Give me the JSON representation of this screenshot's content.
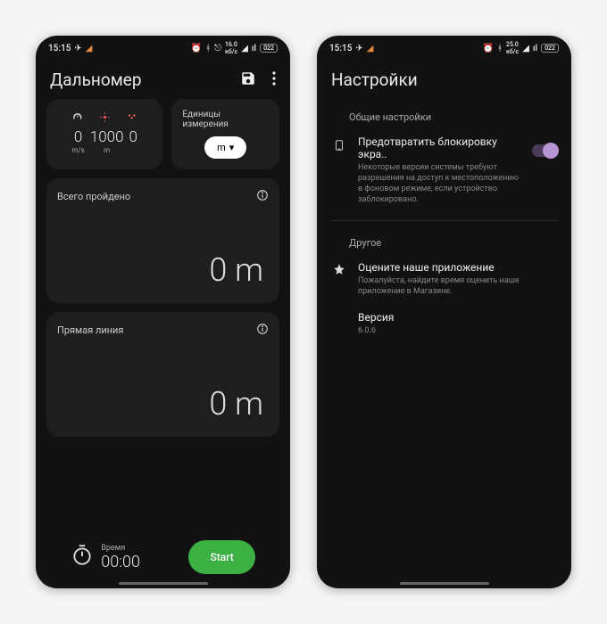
{
  "screen1": {
    "status": {
      "time": "15:15",
      "battery": "022"
    },
    "header": {
      "title": "Дальномер"
    },
    "stats": {
      "speed": {
        "value": "0",
        "unit": "m/s"
      },
      "accuracy": {
        "value": "1000",
        "unit": "m"
      },
      "sats": {
        "value": "0",
        "unit": ""
      }
    },
    "units": {
      "title": "Единицы измерения",
      "selected": "m"
    },
    "card1": {
      "title": "Всего пройдено",
      "value": "0 m"
    },
    "card2": {
      "title": "Прямая линия",
      "value": "0 m"
    },
    "time": {
      "label": "Время",
      "value": "00:00"
    },
    "start": "Start"
  },
  "screen2": {
    "status": {
      "time": "15:15",
      "battery": "022"
    },
    "header": {
      "title": "Настройки"
    },
    "section1": "Общие настройки",
    "wakelock": {
      "title": "Предотвратить блокировку экра..",
      "desc": "Некоторые версии системы требуют разрешения на доступ к местоположению в фоновом режиме, если устройство заблокировано."
    },
    "section2": "Другое",
    "rate": {
      "title": "Оцените наше приложение",
      "desc": "Пожалуйста, найдите время оценить наше приложение в Магазине."
    },
    "version": {
      "title": "Версия",
      "value": "6.0.6"
    }
  }
}
